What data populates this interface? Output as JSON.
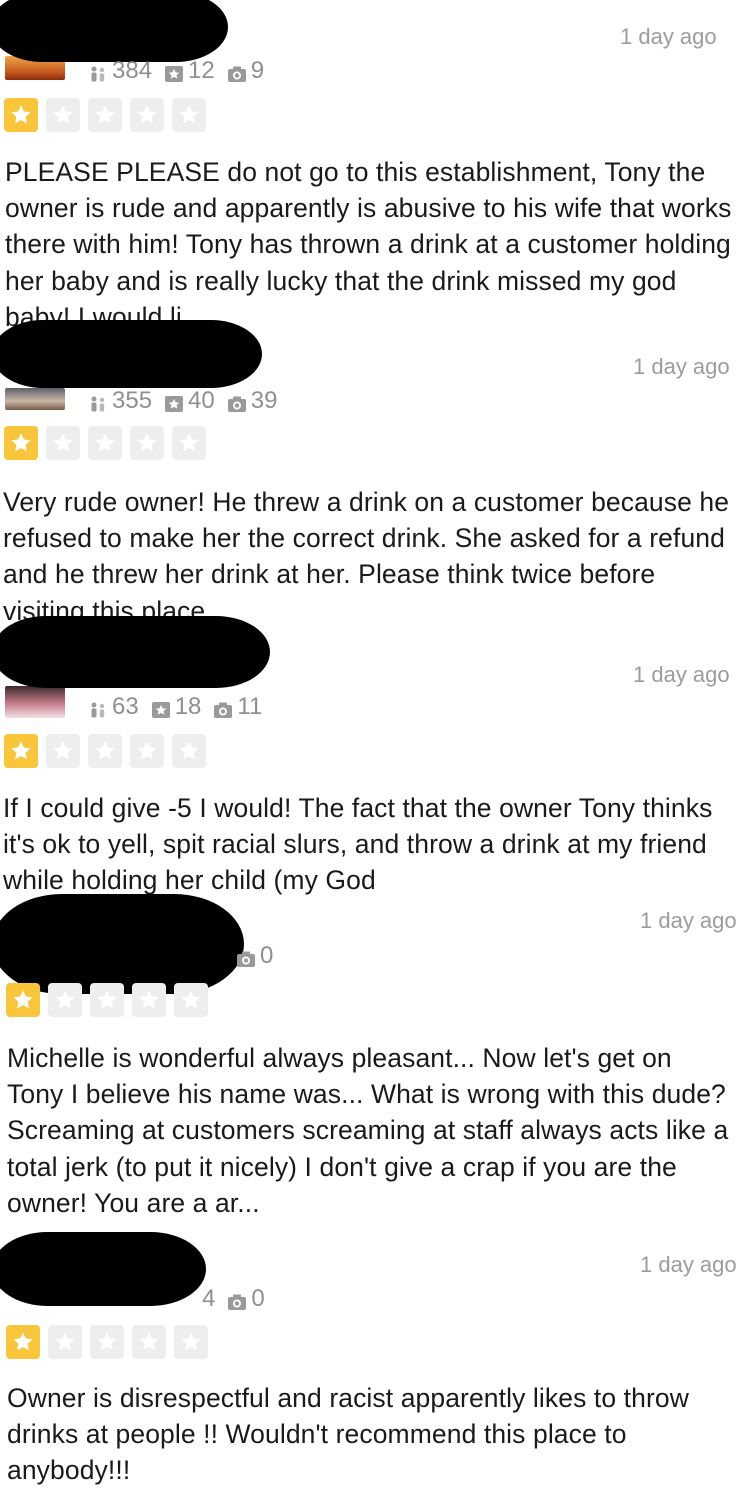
{
  "reviews": [
    {
      "time": "1 day ago",
      "friends": "384",
      "reviews_count": "12",
      "photos": "9",
      "rating": 1,
      "text": "PLEASE PLEASE do not go to this establishment, Tony the owner is rude and apparently is abusive to his wife that works there with him! Tony has thrown a drink at a customer holding her baby and is really lucky that the drink missed my god baby! I would li..."
    },
    {
      "time": "1 day ago",
      "friends": "355",
      "reviews_count": "40",
      "photos": "39",
      "rating": 1,
      "text": "Very rude owner! He threw a drink on a customer because he refused to make her the correct drink. She asked for a refund and he threw her drink at her. Please think twice before visiting this place ."
    },
    {
      "time": "1 day ago",
      "friends": "63",
      "reviews_count": "18",
      "photos": "11",
      "rating": 1,
      "text": "If I could give -5 I would! The fact that the owner Tony thinks it's ok to yell, spit racial slurs, and throw a drink at my friend while holding her child (my God"
    },
    {
      "time": "1 day ago",
      "friends": "",
      "reviews_count": "",
      "photos": "0",
      "rating": 1,
      "text": "Michelle is wonderful always pleasant... Now let's get on Tony I believe his name was... What is wrong with this dude? Screaming at customers screaming at staff always acts like a total jerk (to put it nicely) I don't give a crap if you are the owner! You are a ar..."
    },
    {
      "time": "1 day ago",
      "friends": "",
      "reviews_count": "4",
      "photos": "0",
      "rating": 1,
      "text": "Owner is disrespectful and racist apparently likes to throw drinks at people !! Wouldn't recommend this place to anybody!!!"
    }
  ],
  "colors": {
    "star_filled": "#f9c53a",
    "star_empty": "#eeeeee",
    "meta_text": "#9c9c9c",
    "body_text": "#1a1a1a"
  },
  "icons": {
    "friends": "friends-icon",
    "reviews": "review-star-icon",
    "photos": "camera-icon",
    "rating": "star-icon"
  }
}
